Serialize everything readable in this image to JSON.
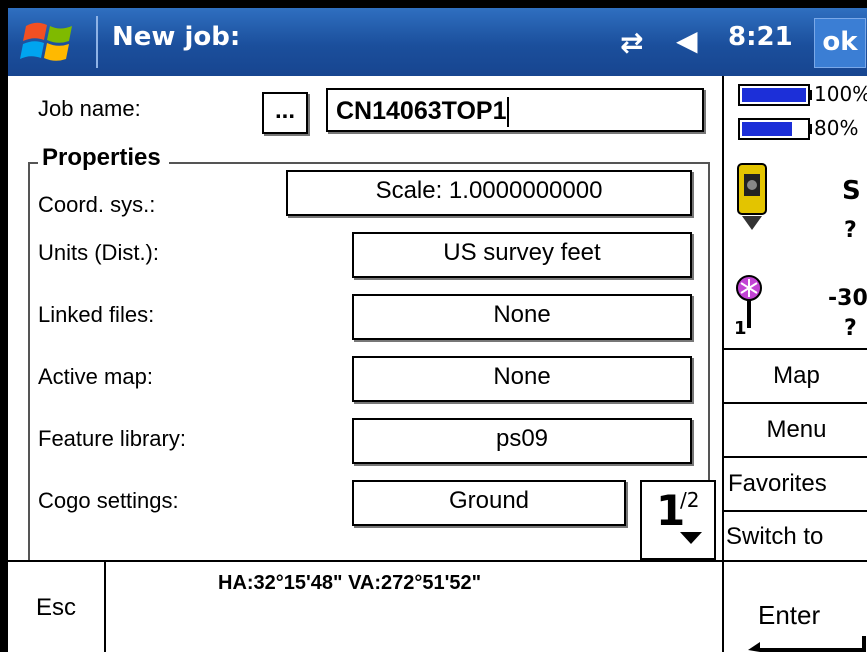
{
  "titlebar": {
    "title": "New job:",
    "time": "8:21",
    "ok_label": "ok",
    "icons": [
      "windows-logo-icon",
      "sync-icon",
      "speaker-icon"
    ]
  },
  "form": {
    "job_name_label": "Job name:",
    "browse_label": "...",
    "job_name_value": "CN14063TOP1",
    "properties_title": "Properties",
    "fields": [
      {
        "label": "Coord. sys.:",
        "value": "Scale:  1.0000000000"
      },
      {
        "label": "Units (Dist.):",
        "value": "US survey feet"
      },
      {
        "label": "Linked files:",
        "value": "None"
      },
      {
        "label": "Active map:",
        "value": "None"
      },
      {
        "label": "Feature library:",
        "value": "ps09"
      },
      {
        "label": "Cogo settings:",
        "value": "Ground"
      }
    ],
    "page_current": "1",
    "page_total": "/2"
  },
  "status_panel": {
    "battery1": "100%",
    "battery1_fraction": 1.0,
    "battery2": "80%",
    "battery2_fraction": 0.8,
    "instrument_letter": "S",
    "instrument_q": "?",
    "target_value": "-30",
    "target_q": "?",
    "target_num": "1",
    "battery_color": "#1c2fd8"
  },
  "side_buttons": {
    "map": "Map",
    "menu": "Menu",
    "favorites": "Favorites",
    "switch": "Switch to"
  },
  "bottom": {
    "esc": "Esc",
    "angles": "HA:32°15'48\"  VA:272°51'52\"",
    "enter": "Enter"
  },
  "colors": {
    "titlebar": "#1b4f9c",
    "accent": "#3b7ed4"
  }
}
